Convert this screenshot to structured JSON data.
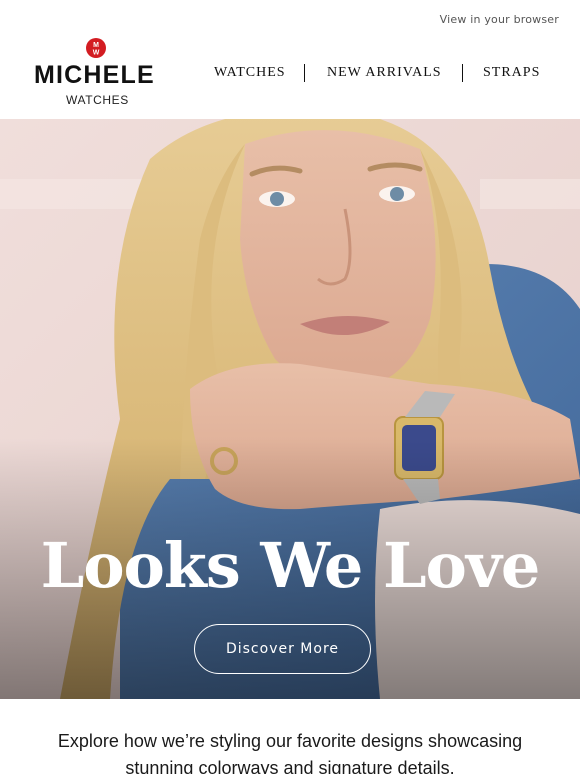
{
  "topbar": {
    "view_in_browser": "View in your browser"
  },
  "brand": {
    "badge_letters": "MW",
    "name": "MICHELE",
    "sub": "WATCHES"
  },
  "nav": {
    "items": [
      {
        "label": "WATCHES"
      },
      {
        "label": "NEW ARRIVALS"
      },
      {
        "label": "STRAPS"
      }
    ]
  },
  "hero": {
    "title": "Looks We Love",
    "cta_label": "Discover More"
  },
  "intro": {
    "text": "Explore how we’re styling our favorite designs showcasing stunning colorways and signature details."
  },
  "colors": {
    "brand_red": "#d31c22",
    "text": "#1a1a1a"
  }
}
